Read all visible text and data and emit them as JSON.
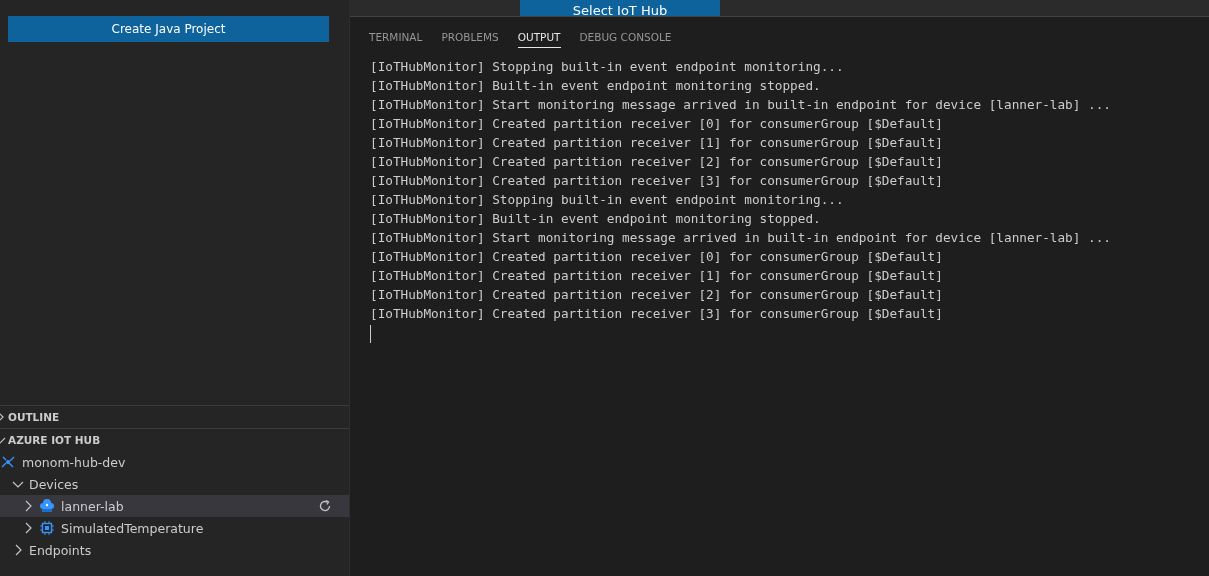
{
  "sidebar": {
    "button": "Create Java Project",
    "sections": [
      {
        "title": "OUTLINE",
        "expanded": false
      },
      {
        "title": "AZURE IOT HUB",
        "expanded": true
      }
    ],
    "tree": [
      {
        "label": "monom-hub-dev",
        "kind": "hub",
        "children": [
          {
            "label": "Devices",
            "expanded": true,
            "selected": false,
            "children": [
              {
                "label": "lanner-lab",
                "kind": "device",
                "expanded": false,
                "selected": true
              },
              {
                "label": "SimulatedTemperature",
                "kind": "module",
                "expanded": false,
                "selected": false
              }
            ]
          },
          {
            "label": "Endpoints",
            "expanded": false,
            "selected": false
          }
        ]
      }
    ]
  },
  "top_button": "Select IoT Hub",
  "panel": {
    "tabs": [
      {
        "label": "TERMINAL",
        "selected": false
      },
      {
        "label": "PROBLEMS",
        "selected": false
      },
      {
        "label": "OUTPUT",
        "selected": true
      },
      {
        "label": "DEBUG CONSOLE",
        "selected": false
      }
    ],
    "lines": [
      "[IoTHubMonitor] Stopping built-in event endpoint monitoring...",
      "[IoTHubMonitor] Built-in event endpoint monitoring stopped.",
      "[IoTHubMonitor] Start monitoring message arrived in built-in endpoint for device [lanner-lab] ...",
      "[IoTHubMonitor] Created partition receiver [0] for consumerGroup [$Default]",
      "[IoTHubMonitor] Created partition receiver [1] for consumerGroup [$Default]",
      "[IoTHubMonitor] Created partition receiver [2] for consumerGroup [$Default]",
      "[IoTHubMonitor] Created partition receiver [3] for consumerGroup [$Default]",
      "[IoTHubMonitor] Stopping built-in event endpoint monitoring...",
      "[IoTHubMonitor] Built-in event endpoint monitoring stopped.",
      "[IoTHubMonitor] Start monitoring message arrived in built-in endpoint for device [lanner-lab] ...",
      "[IoTHubMonitor] Created partition receiver [0] for consumerGroup [$Default]",
      "[IoTHubMonitor] Created partition receiver [1] for consumerGroup [$Default]",
      "[IoTHubMonitor] Created partition receiver [2] for consumerGroup [$Default]",
      "[IoTHubMonitor] Created partition receiver [3] for consumerGroup [$Default]"
    ]
  }
}
